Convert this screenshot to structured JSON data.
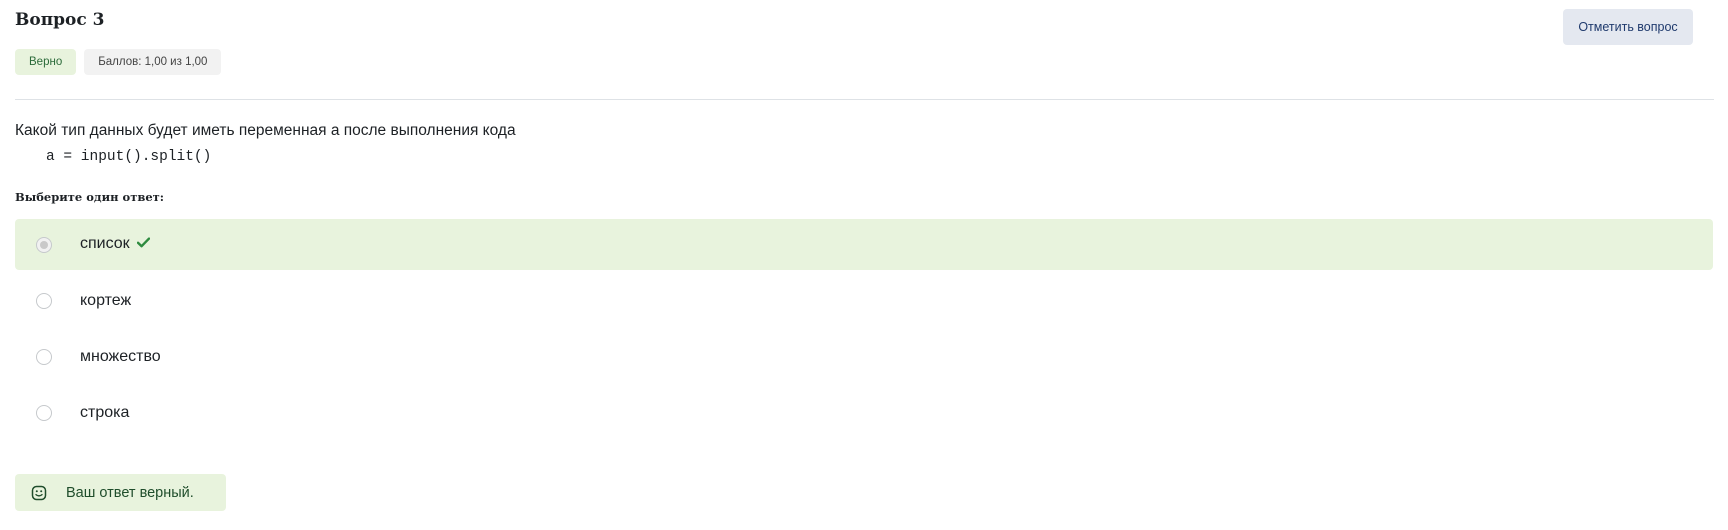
{
  "question": {
    "title": "Вопрос 3",
    "status_badge": "Верно",
    "score_badge": "Баллов: 1,00 из 1,00",
    "flag_button": "Отметить вопрос",
    "text": "Какой тип данных будет иметь переменная a после выполнения кода",
    "code": "a = input().split()",
    "prompt": "Выберите один ответ:"
  },
  "answers": [
    {
      "label": "список",
      "selected": true,
      "correct": true
    },
    {
      "label": "кортеж",
      "selected": false,
      "correct": false
    },
    {
      "label": "множество",
      "selected": false,
      "correct": false
    },
    {
      "label": "строка",
      "selected": false,
      "correct": false
    }
  ],
  "feedback": {
    "text": "Ваш ответ верный.",
    "icon": "smile-icon"
  },
  "colors": {
    "correct_bg": "#e8f3dd",
    "correct_check": "#2e8b3f",
    "flag_bg": "#e4e8f0"
  }
}
